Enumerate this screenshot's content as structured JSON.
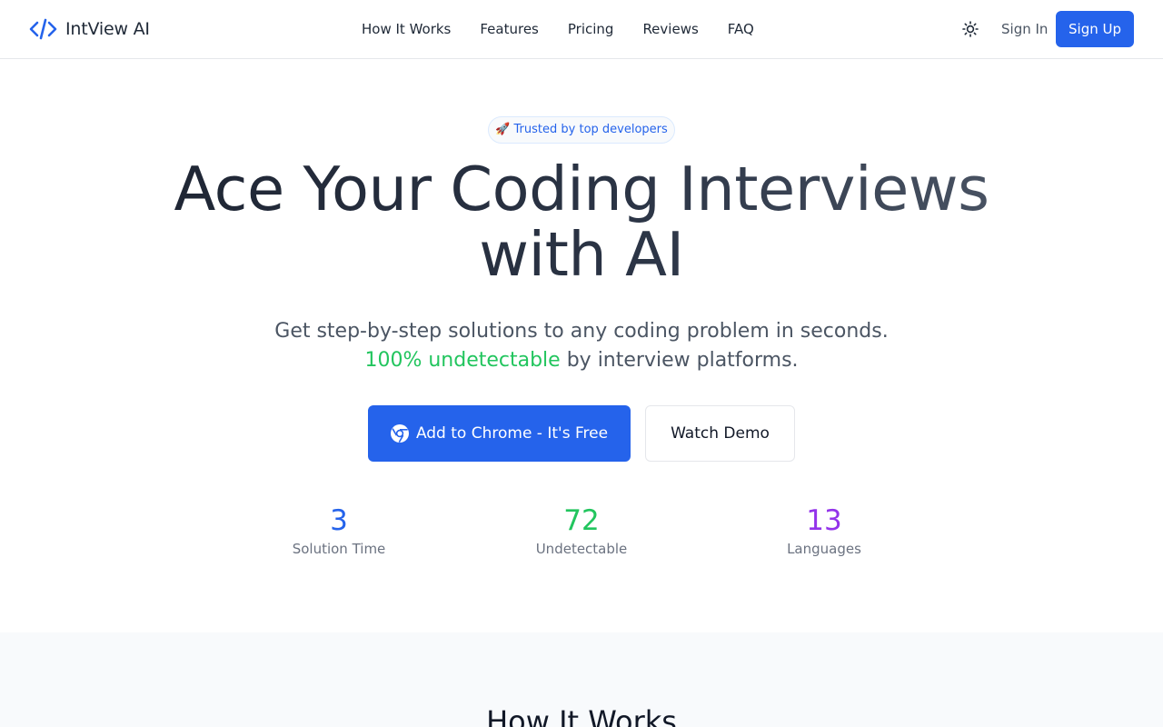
{
  "header": {
    "brand": "IntView AI",
    "nav": [
      "How It Works",
      "Features",
      "Pricing",
      "Reviews",
      "FAQ"
    ],
    "sign_in": "Sign In",
    "sign_up": "Sign Up"
  },
  "hero": {
    "badge": "🚀 Trusted by top developers",
    "headline_line1": "Ace Your Coding Interviews",
    "headline_line2": "with AI",
    "sub_before": "Get step-by-step solutions to any coding problem in seconds.",
    "sub_highlight": "100% undetectable",
    "sub_after": "by interview platforms.",
    "cta_primary": "Add to Chrome - It's Free",
    "cta_secondary": "Watch Demo",
    "stats": [
      {
        "value": "3",
        "label": "Solution Time",
        "color": "#2563eb"
      },
      {
        "value": "72",
        "label": "Undetectable",
        "color": "#22c55e"
      },
      {
        "value": "13",
        "label": "Languages",
        "color": "#9333ea"
      }
    ]
  },
  "how_it_works": {
    "title": "How It Works"
  },
  "colors": {
    "accent": "#2563eb",
    "highlight": "#22c55e",
    "purple": "#9333ea"
  },
  "icons": [
    "code-brackets-icon",
    "sun-icon",
    "chrome-icon"
  ]
}
